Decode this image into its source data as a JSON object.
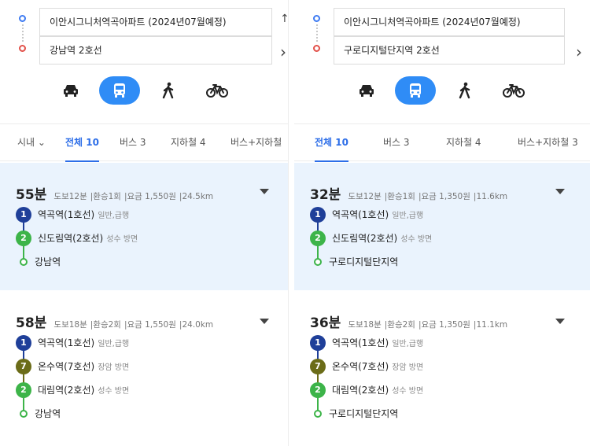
{
  "left": {
    "origin": "이안시그니처역곡아파트 (2024년07월예정)",
    "destination": "강남역 2호선",
    "swap_glyph": "↑",
    "more_glyph": "›",
    "tabs": {
      "area": "시내",
      "all": "전체 10",
      "bus": "버스 3",
      "subway": "지하철 4",
      "bus_subway": "버스+지하철"
    },
    "results": [
      {
        "minutes": "55분",
        "walk": "도보12분",
        "transfer": "환승1회",
        "fare": "요금 1,550원",
        "distance": "24.5km",
        "steps": [
          {
            "badge": "1",
            "name": "역곡역(1호선)",
            "dir": "일반,급행"
          },
          {
            "badge": "2",
            "name": "신도림역(2호선)",
            "dir": "성수 방면"
          },
          {
            "badge": "",
            "name": "강남역",
            "dir": ""
          }
        ]
      },
      {
        "minutes": "58분",
        "walk": "도보18분",
        "transfer": "환승2회",
        "fare": "요금 1,550원",
        "distance": "24.0km",
        "steps": [
          {
            "badge": "1",
            "name": "역곡역(1호선)",
            "dir": "일반,급행"
          },
          {
            "badge": "7",
            "name": "온수역(7호선)",
            "dir": "장암 방면"
          },
          {
            "badge": "2",
            "name": "대림역(2호선)",
            "dir": "성수 방면"
          },
          {
            "badge": "",
            "name": "강남역",
            "dir": ""
          }
        ]
      }
    ]
  },
  "right": {
    "origin": "이안시그니처역곡아파트 (2024년07월예정)",
    "destination": "구로디지털단지역 2호선",
    "swap_glyph": "↑",
    "more_glyph": "›",
    "tabs": {
      "all": "전체 10",
      "bus": "버스 3",
      "subway": "지하철 4",
      "bus_subway": "버스+지하철 3"
    },
    "results": [
      {
        "minutes": "32분",
        "walk": "도보12분",
        "transfer": "환승1회",
        "fare": "요금 1,350원",
        "distance": "11.6km",
        "steps": [
          {
            "badge": "1",
            "name": "역곡역(1호선)",
            "dir": "일반,급행"
          },
          {
            "badge": "2",
            "name": "신도림역(2호선)",
            "dir": "성수 방면"
          },
          {
            "badge": "",
            "name": "구로디지털단지역",
            "dir": ""
          }
        ]
      },
      {
        "minutes": "36분",
        "walk": "도보18분",
        "transfer": "환승2회",
        "fare": "요금 1,350원",
        "distance": "11.1km",
        "steps": [
          {
            "badge": "1",
            "name": "역곡역(1호선)",
            "dir": "일반,급행"
          },
          {
            "badge": "7",
            "name": "온수역(7호선)",
            "dir": "장암 방면"
          },
          {
            "badge": "2",
            "name": "대림역(2호선)",
            "dir": "성수 방면"
          },
          {
            "badge": "",
            "name": "구로디지털단지역",
            "dir": ""
          }
        ]
      }
    ]
  },
  "colors": {
    "accent": "#2f8cf6",
    "line1": "#1f3f99",
    "line2": "#3db449",
    "line7": "#6b6c18",
    "highlight": "#eaf3fd"
  }
}
